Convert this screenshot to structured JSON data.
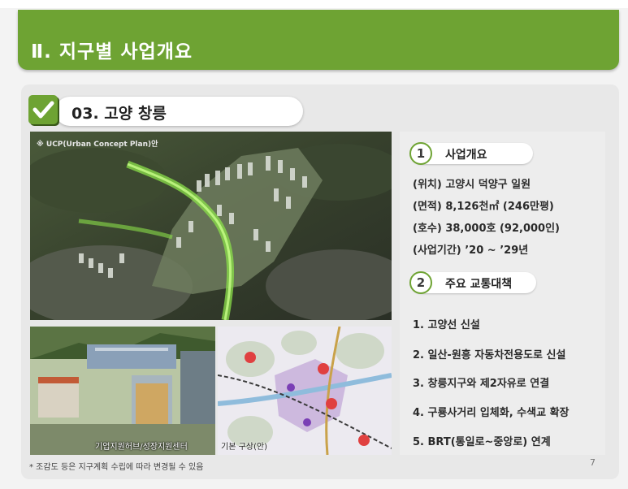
{
  "header": {
    "title": "Ⅱ. 지구별 사업개요"
  },
  "section": {
    "title": "03. 고양 창릉"
  },
  "images": {
    "aerial_note": "※ UCP(Urban Concept Plan)안",
    "render_caption": "기업지원허브/성장지원센터",
    "plan_caption": "기본 구상(안)"
  },
  "overview": {
    "number": "1",
    "title": "사업개요",
    "lines": [
      "(위치) 고양시 덕양구 일원",
      "(면적) 8,126천㎡ (246만평)",
      "(호수) 38,000호 (92,000인)",
      "(사업기간) ’20 ~ ’29년"
    ]
  },
  "transport": {
    "number": "2",
    "title": "주요 교통대책",
    "items": [
      "1. 고양선 신설",
      "2. 일산-원흥 자동차전용도로 신설",
      "3. 창릉지구와 제2자유로 연결",
      "4. 구룡사거리 입체화, 수색교 확장",
      "5. BRT(통일로~중앙로) 연계"
    ]
  },
  "footnote": "* 조감도 등은 지구계획 수립에 따라 변경될 수 있음",
  "page_number": "7",
  "colors": {
    "accent": "#6ea333",
    "background": "#f3f3f3",
    "card": "#e8e8e8"
  }
}
